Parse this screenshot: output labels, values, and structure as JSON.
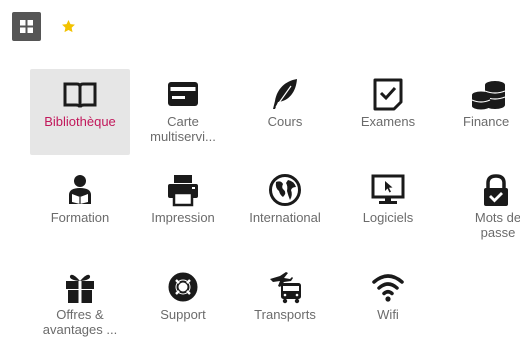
{
  "colors": {
    "toolbar_button": "#555555",
    "star": "#f2c200",
    "active_tile_bg": "#e6e6e6",
    "active_label": "#c2185b",
    "label": "#6b6b6b",
    "icon": "#1a1a1a"
  },
  "toolbar": {
    "grid_icon": "grid-icon",
    "favorite_icon": "star-icon"
  },
  "tiles": [
    {
      "label": "Bibliothèque",
      "icon": "book-icon",
      "active": true
    },
    {
      "label": "Carte multiservi...",
      "icon": "credit-card-icon"
    },
    {
      "label": "Cours",
      "icon": "feather-icon"
    },
    {
      "label": "Examens",
      "icon": "checkbox-icon"
    },
    {
      "label": "Finance",
      "icon": "coins-icon"
    },
    {
      "label": "Formation",
      "icon": "reader-icon"
    },
    {
      "label": "Impression",
      "icon": "printer-icon"
    },
    {
      "label": "International",
      "icon": "globe-icon"
    },
    {
      "label": "Logiciels",
      "icon": "monitor-cursor-icon"
    },
    {
      "label": "Mots de passe",
      "icon": "lock-check-icon"
    },
    {
      "label": "Offres & avantages ...",
      "icon": "gift-icon"
    },
    {
      "label": "Support",
      "icon": "lifebuoy-icon"
    },
    {
      "label": "Transports",
      "icon": "plane-bus-icon"
    },
    {
      "label": "Wifi",
      "icon": "wifi-icon"
    }
  ]
}
